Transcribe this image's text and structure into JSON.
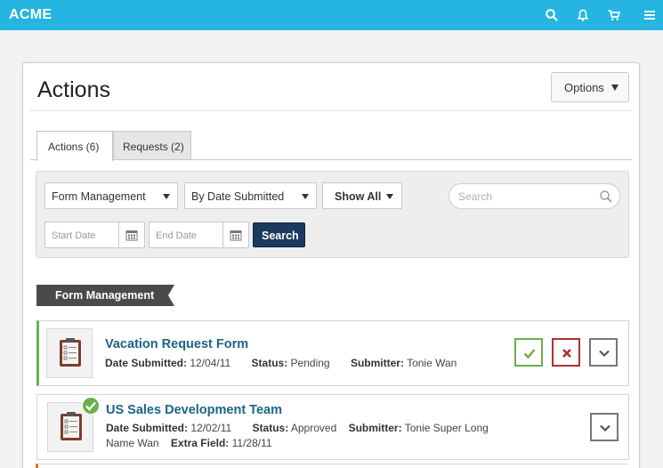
{
  "app": {
    "brand": "ACME"
  },
  "topbar_icons": [
    "search-icon",
    "bell-icon",
    "cart-icon",
    "hamburger-menu-icon"
  ],
  "colors": {
    "topbar": "#25b5e0",
    "approve": "#6ab04c",
    "reject": "#b03030",
    "primary_button": "#1c3a5e",
    "link": "#1b6489"
  },
  "page": {
    "title": "Actions",
    "options_label": "Options"
  },
  "tabs": [
    {
      "label": "Actions (6)",
      "active": true
    },
    {
      "label": "Requests (2)",
      "active": false
    }
  ],
  "filters": {
    "category": "Form Management",
    "sort": "By Date Submitted",
    "show": "Show All",
    "search_placeholder": "Search",
    "start_date_placeholder": "Start Date",
    "end_date_placeholder": "End Date",
    "search_button": "Search"
  },
  "section": {
    "title": "Form Management"
  },
  "items": [
    {
      "title": "Vacation Request Form",
      "date_label": "Date Submitted:",
      "date": "12/04/11",
      "status_label": "Status:",
      "status": "Pending",
      "submitter_label": "Submitter:",
      "submitter": "Tonie Wan",
      "icons": [
        "clipboard-icon",
        "check-icon",
        "x-icon",
        "chevron-down-icon"
      ]
    },
    {
      "title": "US Sales Development Team",
      "date_label": "Date Submitted:",
      "date": "12/02/11",
      "status_label": "Status:",
      "status": "Approved",
      "submitter_label": "Submitter:",
      "submitter": "Tonie Super Long",
      "submitter_cont": "Name Wan",
      "extra_label": "Extra Field:",
      "extra": "11/28/11",
      "icons": [
        "clipboard-icon",
        "approved-check-icon",
        "chevron-down-icon"
      ]
    }
  ]
}
